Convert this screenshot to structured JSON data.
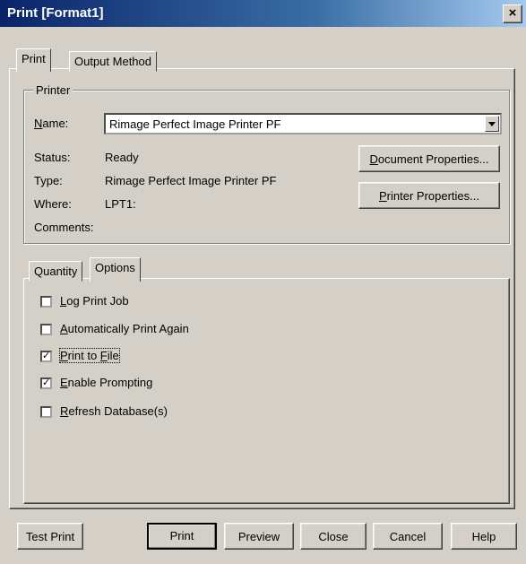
{
  "window": {
    "title": "Print [Format1]",
    "close_glyph": "×"
  },
  "tabs": {
    "print": "Print",
    "output_method": "Output Method"
  },
  "printer": {
    "group_label": "Printer",
    "name_label": "Name:",
    "name_value": "Rimage Perfect Image Printer PF",
    "status_label": "Status:",
    "status_value": "Ready",
    "type_label": "Type:",
    "type_value": "Rimage Perfect Image Printer PF",
    "where_label": "Where:",
    "where_value": "LPT1:",
    "comments_label": "Comments:",
    "document_properties": "Document Properties...",
    "printer_properties": "Printer Properties..."
  },
  "subtabs": {
    "quantity": "Quantity",
    "options": "Options"
  },
  "options": [
    {
      "label": "Log Print Job",
      "checked": false
    },
    {
      "label": "Automatically Print Again",
      "checked": false
    },
    {
      "label": "Print to File",
      "checked": true
    },
    {
      "label": "Enable Prompting",
      "checked": true
    },
    {
      "label": "Refresh Database(s)",
      "checked": false
    }
  ],
  "buttons": {
    "test_print": "Test Print",
    "print": "Print",
    "preview": "Preview",
    "close": "Close",
    "cancel": "Cancel",
    "help": "Help"
  }
}
